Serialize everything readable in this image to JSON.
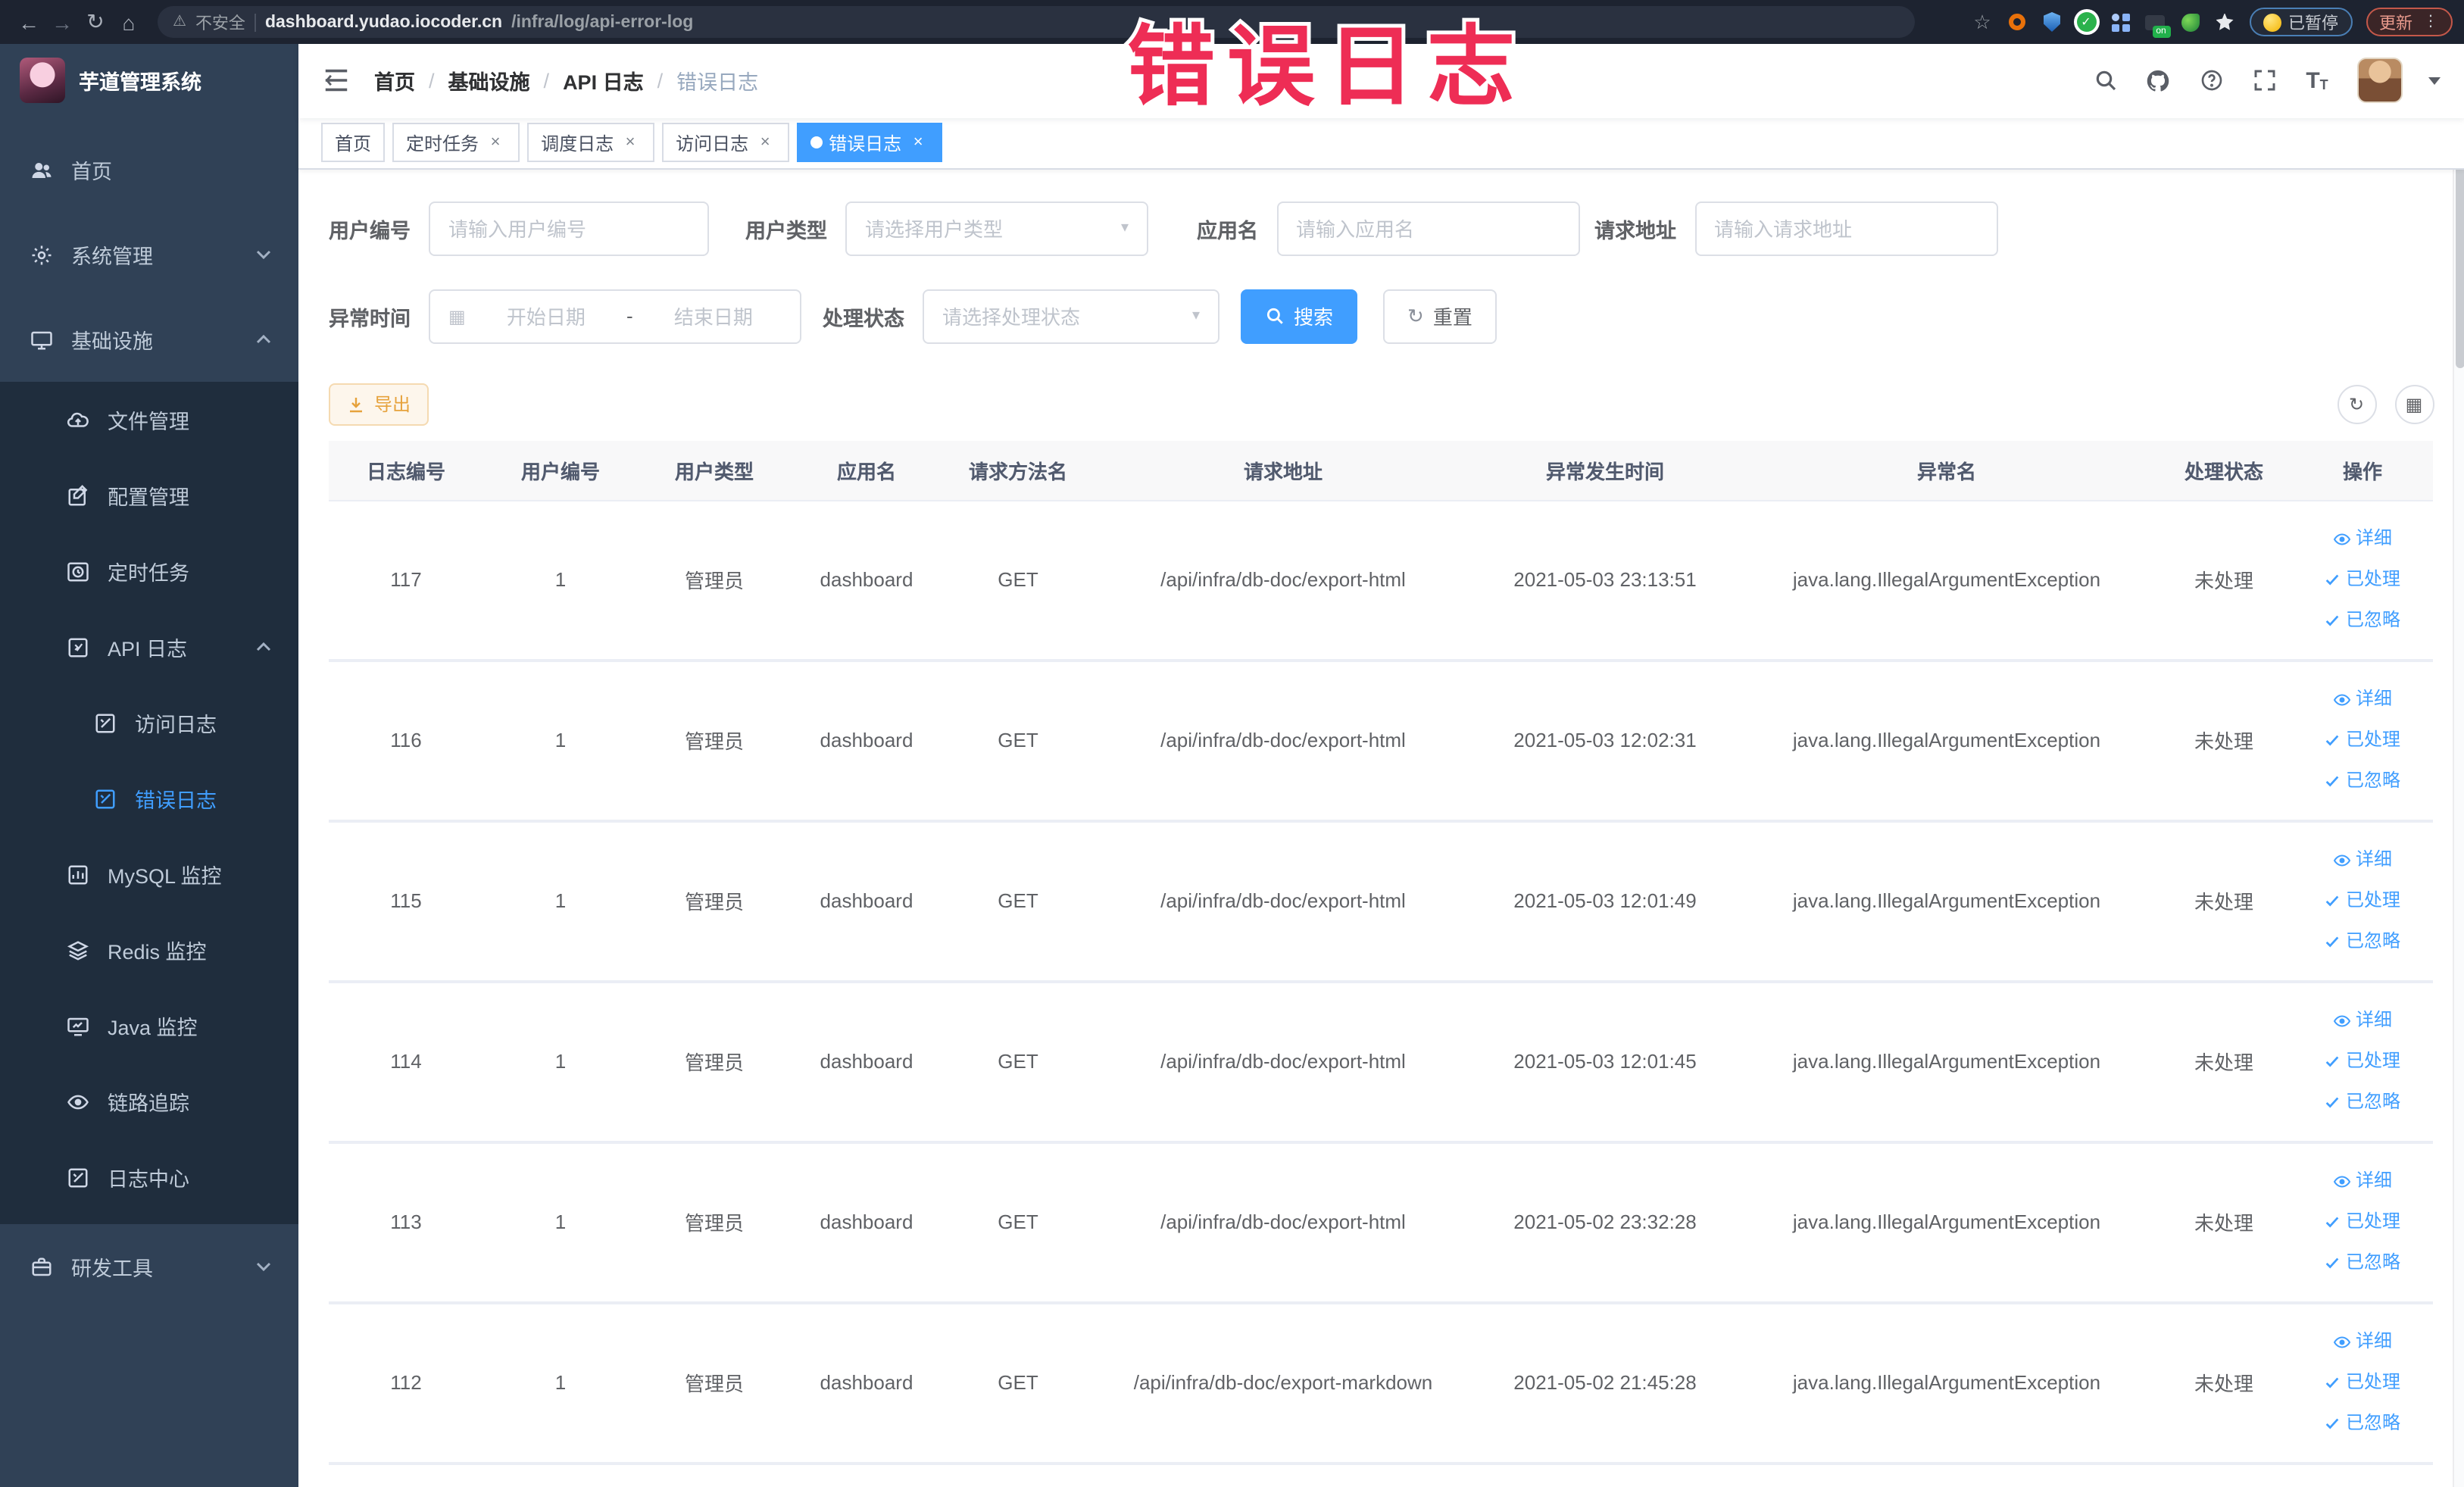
{
  "browser": {
    "security_label": "不安全",
    "url_host": "dashboard.yudao.iocoder.cn",
    "url_path": "/infra/log/api-error-log",
    "paused_badge": "已暂停",
    "update_button": "更新"
  },
  "overlay": {
    "text": "错误日志",
    "color": "#ee2d55"
  },
  "sidebar": {
    "logo_title": "芋道管理系统",
    "menu": [
      {
        "label": "首页",
        "icon": "people-icon"
      },
      {
        "label": "系统管理",
        "icon": "gear-icon",
        "chevron": "down"
      },
      {
        "label": "基础设施",
        "icon": "monitor-icon",
        "chevron": "up"
      },
      {
        "label": "文件管理",
        "icon": "cloud-icon"
      },
      {
        "label": "配置管理",
        "icon": "edit-icon"
      },
      {
        "label": "定时任务",
        "icon": "clock-icon"
      },
      {
        "label": "API 日志",
        "icon": "doc-icon",
        "chevron": "up"
      },
      {
        "label": "访问日志",
        "icon": "doc-icon"
      },
      {
        "label": "错误日志",
        "icon": "doc-icon",
        "active": true
      },
      {
        "label": "MySQL 监控",
        "icon": "chart-icon"
      },
      {
        "label": "Redis 监控",
        "icon": "layers-icon"
      },
      {
        "label": "Java 监控",
        "icon": "screen-icon"
      },
      {
        "label": "链路追踪",
        "icon": "eye-icon"
      },
      {
        "label": "日志中心",
        "icon": "doc-icon"
      },
      {
        "label": "研发工具",
        "icon": "briefcase-icon",
        "chevron": "down"
      }
    ]
  },
  "breadcrumb": [
    "首页",
    "基础设施",
    "API 日志",
    "错误日志"
  ],
  "tabs": [
    {
      "label": "首页",
      "closable": false,
      "active": false
    },
    {
      "label": "定时任务",
      "closable": true,
      "active": false
    },
    {
      "label": "调度日志",
      "closable": true,
      "active": false
    },
    {
      "label": "访问日志",
      "closable": true,
      "active": false
    },
    {
      "label": "错误日志",
      "closable": true,
      "active": true
    }
  ],
  "filters": {
    "user_id": {
      "label": "用户编号",
      "placeholder": "请输入用户编号"
    },
    "user_type": {
      "label": "用户类型",
      "placeholder": "请选择用户类型"
    },
    "app_name": {
      "label": "应用名",
      "placeholder": "请输入应用名"
    },
    "request_url": {
      "label": "请求地址",
      "placeholder": "请输入请求地址"
    },
    "exception_time": {
      "label": "异常时间",
      "start_placeholder": "开始日期",
      "separator": "-",
      "end_placeholder": "结束日期"
    },
    "process_status": {
      "label": "处理状态",
      "placeholder": "请选择处理状态"
    },
    "search_button": "搜索",
    "reset_button": "重置"
  },
  "toolbar": {
    "export_button": "导出"
  },
  "table": {
    "columns": [
      "日志编号",
      "用户编号",
      "用户类型",
      "应用名",
      "请求方法名",
      "请求地址",
      "异常发生时间",
      "异常名",
      "处理状态",
      "操作"
    ],
    "actions": [
      "详细",
      "已处理",
      "已忽略"
    ],
    "rows": [
      {
        "id": "117",
        "user_id": "1",
        "user_type": "管理员",
        "app": "dashboard",
        "method": "GET",
        "url": "/api/infra/db-doc/export-html",
        "time": "2021-05-03 23:13:51",
        "exception": "java.lang.IllegalArgumentException",
        "status": "未处理"
      },
      {
        "id": "116",
        "user_id": "1",
        "user_type": "管理员",
        "app": "dashboard",
        "method": "GET",
        "url": "/api/infra/db-doc/export-html",
        "time": "2021-05-03 12:02:31",
        "exception": "java.lang.IllegalArgumentException",
        "status": "未处理"
      },
      {
        "id": "115",
        "user_id": "1",
        "user_type": "管理员",
        "app": "dashboard",
        "method": "GET",
        "url": "/api/infra/db-doc/export-html",
        "time": "2021-05-03 12:01:49",
        "exception": "java.lang.IllegalArgumentException",
        "status": "未处理"
      },
      {
        "id": "114",
        "user_id": "1",
        "user_type": "管理员",
        "app": "dashboard",
        "method": "GET",
        "url": "/api/infra/db-doc/export-html",
        "time": "2021-05-03 12:01:45",
        "exception": "java.lang.IllegalArgumentException",
        "status": "未处理"
      },
      {
        "id": "113",
        "user_id": "1",
        "user_type": "管理员",
        "app": "dashboard",
        "method": "GET",
        "url": "/api/infra/db-doc/export-html",
        "time": "2021-05-02 23:32:28",
        "exception": "java.lang.IllegalArgumentException",
        "status": "未处理"
      },
      {
        "id": "112",
        "user_id": "1",
        "user_type": "管理员",
        "app": "dashboard",
        "method": "GET",
        "url": "/api/infra/db-doc/export-markdown",
        "time": "2021-05-02 21:45:28",
        "exception": "java.lang.IllegalArgumentException",
        "status": "未处理"
      }
    ]
  },
  "colors": {
    "primary": "#409eff",
    "warning": "#e6a23c",
    "sidebar_bg": "#304156",
    "submenu_bg": "#1f2d3d",
    "chrome_bg": "#1d2330"
  }
}
